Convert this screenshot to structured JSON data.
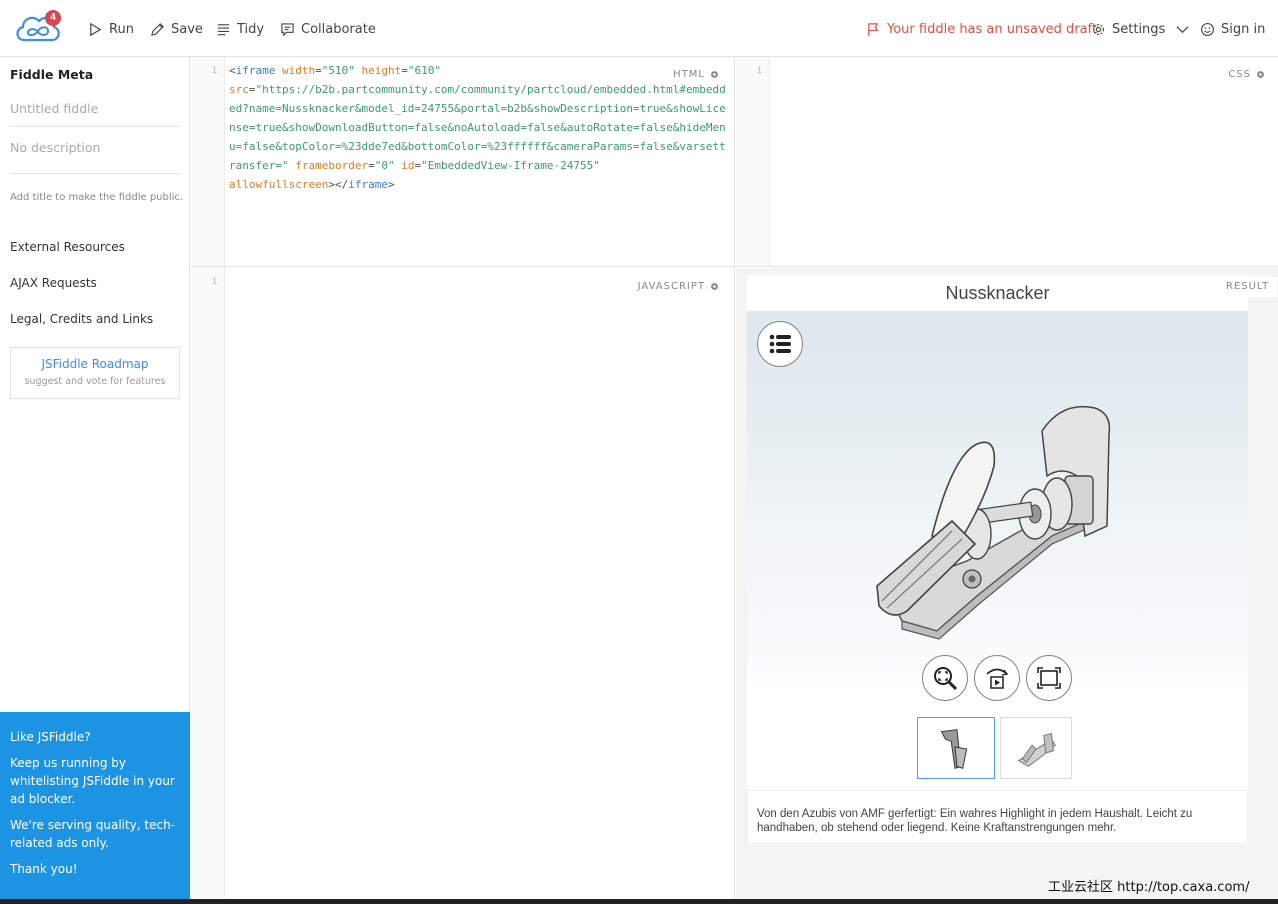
{
  "header": {
    "notification_count": "4",
    "run_label": "Run",
    "save_label": "Save",
    "tidy_label": "Tidy",
    "collaborate_label": "Collaborate",
    "draft_status": "Your fiddle has an unsaved draft",
    "settings_label": "Settings",
    "signin_label": "Sign in",
    "accent_color": "#e24d42"
  },
  "sidebar": {
    "meta_title": "Fiddle Meta",
    "title_placeholder": "Untitled fiddle",
    "description_placeholder": "No description",
    "hint": "Add title to make the fiddle public.",
    "links": [
      "External Resources",
      "AJAX Requests",
      "Legal, Credits and Links"
    ],
    "roadmap_title": "JSFiddle Roadmap",
    "roadmap_subtitle": "suggest and vote for features",
    "promo": {
      "heading": "Like JSFiddle?",
      "p1": "Keep us running by whitelisting JSFiddle in your ad blocker.",
      "p2": "We're serving quality, tech-related ads only.",
      "p3": "Thank you!",
      "color": "#1d94e3"
    }
  },
  "panes": {
    "html_label": "HTML",
    "css_label": "CSS",
    "js_label": "JAVASCRIPT",
    "result_label": "RESULT",
    "line_number": "1",
    "html_code": {
      "open": "<",
      "tag": "iframe",
      "attr_width": "width",
      "val_width": "\"510\"",
      "attr_height": "height",
      "val_height": "\"610\"",
      "attr_src": "src",
      "val_src": "\"https://b2b.partcommunity.com/community/partcloud/embedded.html#embedded?name=Nussknacker&model_id=24755&portal=b2b&showDescription=true&showLicense=true&showDownloadButton=false&noAutoload=false&autoRotate=false&hideMenu=false&topColor=%23dde7ed&bottomColor=%23ffffff&cameraParams=false&varsettransfer=\"",
      "attr_frameborder": "frameborder",
      "val_frameborder": "\"0\"",
      "attr_id": "id",
      "val_id": "\"EmbeddedView-Iframe-24755\"",
      "attr_allow": "allowfullscreen",
      "close_open": "></",
      "close": ">"
    }
  },
  "result": {
    "title": "Nussknacker",
    "description": "Von den Azubis von AMF gerfertigt: Ein wahres Highlight in jedem Haushalt. Leicht zu handhaben, ob stehend oder liegend. Keine Kraftanstrengungen mehr.",
    "top_color": "#dde7ed",
    "bottom_color": "#ffffff"
  },
  "watermark": "工业云社区 http://top.caxa.com/"
}
